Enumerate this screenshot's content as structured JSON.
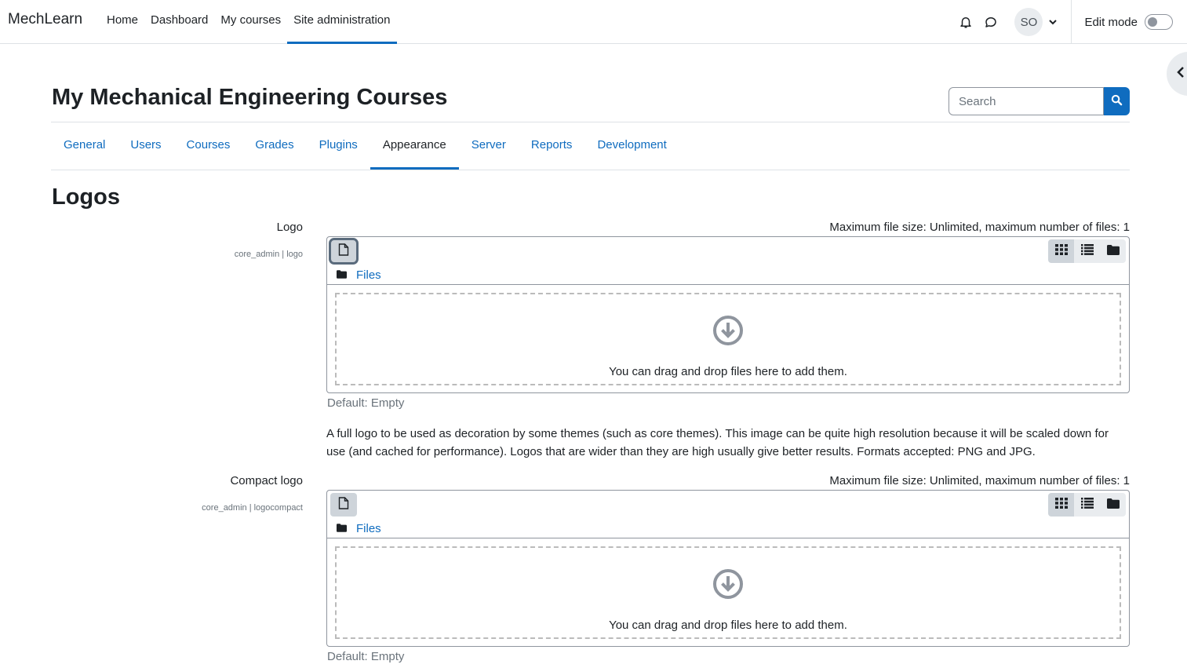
{
  "navbar": {
    "brand": "MechLearn",
    "items": [
      {
        "label": "Home"
      },
      {
        "label": "Dashboard"
      },
      {
        "label": "My courses"
      },
      {
        "label": "Site administration"
      }
    ],
    "avatar_initials": "SO",
    "edit_mode_label": "Edit mode"
  },
  "header": {
    "title": "My Mechanical Engineering Courses",
    "search_placeholder": "Search"
  },
  "tabs": [
    {
      "label": "General"
    },
    {
      "label": "Users"
    },
    {
      "label": "Courses"
    },
    {
      "label": "Grades"
    },
    {
      "label": "Plugins"
    },
    {
      "label": "Appearance"
    },
    {
      "label": "Server"
    },
    {
      "label": "Reports"
    },
    {
      "label": "Development"
    }
  ],
  "section_title": "Logos",
  "settings": [
    {
      "label": "Logo",
      "key": "core_admin | logo",
      "max_size": "Maximum file size: Unlimited, maximum number of files: 1",
      "path_label": "Files",
      "drop_text": "You can drag and drop files here to add them.",
      "default": "Default: Empty",
      "description": "A full logo to be used as decoration by some themes (such as core themes). This image can be quite high resolution because it will be scaled down for use (and cached for performance). Logos that are wider than they are high usually give better results. Formats accepted: PNG and JPG."
    },
    {
      "label": "Compact logo",
      "key": "core_admin | logocompact",
      "max_size": "Maximum file size: Unlimited, maximum number of files: 1",
      "path_label": "Files",
      "drop_text": "You can drag and drop files here to add them.",
      "default": "Default: Empty"
    }
  ],
  "colors": {
    "brand_blue": "#0f6cbf",
    "text": "#1d2125",
    "muted": "#6a737b"
  }
}
